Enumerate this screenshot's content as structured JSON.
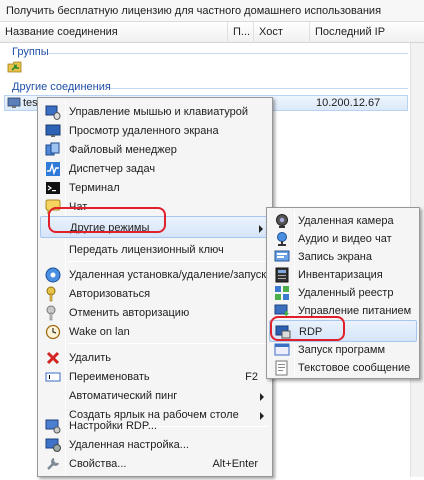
{
  "window": {
    "top_message": "Получить бесплатную лицензию для частного домашнего использования"
  },
  "columns": {
    "name": "Название соединения",
    "p": "П...",
    "host": "Хост",
    "last_ip": "Последний IP"
  },
  "groups": {
    "groups_header": "Группы",
    "other_header": "Другие соединения"
  },
  "connection": {
    "name": "test",
    "last_ip": "10.200.12.67"
  },
  "context_menu": {
    "items": [
      {
        "label": "Управление мышью и клавиатурой",
        "icon": "mouse-icon"
      },
      {
        "label": "Просмотр удаленного экрана",
        "icon": "monitor-icon"
      },
      {
        "label": "Файловый менеджер",
        "icon": "files-icon"
      },
      {
        "label": "Диспетчер задач",
        "icon": "task-manager-icon"
      },
      {
        "label": "Терминал",
        "icon": "terminal-icon"
      },
      {
        "label": "Чат",
        "icon": "chat-icon"
      },
      {
        "label": "Другие режимы",
        "icon": "none"
      },
      {
        "label": "Передать лицензионный ключ",
        "icon": "none"
      },
      {
        "label": "Удаленная установка/удаление/запуск...",
        "icon": "install-icon"
      },
      {
        "label": "Авторизоваться",
        "icon": "key-icon"
      },
      {
        "label": "Отменить авторизацию",
        "icon": "key-off-icon"
      },
      {
        "label": "Wake on lan",
        "icon": "clock-icon"
      },
      {
        "label": "Удалить",
        "icon": "delete-icon"
      },
      {
        "label": "Переименовать",
        "icon": "rename-icon",
        "shortcut": "F2"
      },
      {
        "label": "Автоматический пинг",
        "icon": "none"
      },
      {
        "label": "Создать ярлык на рабочем столе",
        "icon": "none"
      },
      {
        "label": "Настройки RDP...",
        "icon": "rdp-settings-icon"
      },
      {
        "label": "Удаленная настройка...",
        "icon": "remote-settings-icon"
      },
      {
        "label": "Свойства...",
        "icon": "wrench-icon",
        "shortcut": "Alt+Enter"
      }
    ]
  },
  "submenu": {
    "items": [
      {
        "label": "Удаленная камера",
        "icon": "camera-icon"
      },
      {
        "label": "Аудио и видео чат",
        "icon": "av-chat-icon"
      },
      {
        "label": "Запись экрана",
        "icon": "screen-record-icon"
      },
      {
        "label": "Инвентаризация",
        "icon": "inventory-icon"
      },
      {
        "label": "Удаленный реестр",
        "icon": "registry-icon"
      },
      {
        "label": "Управление питанием",
        "icon": "power-icon"
      },
      {
        "label": "RDP",
        "icon": "rdp-icon"
      },
      {
        "label": "Запуск программ",
        "icon": "run-program-icon"
      },
      {
        "label": "Текстовое сообщение",
        "icon": "message-icon"
      }
    ]
  },
  "colors": {
    "group_header": "#1f4fa8",
    "highlight_box": "#e0202a",
    "menu_bg": "#f5f5f5"
  }
}
